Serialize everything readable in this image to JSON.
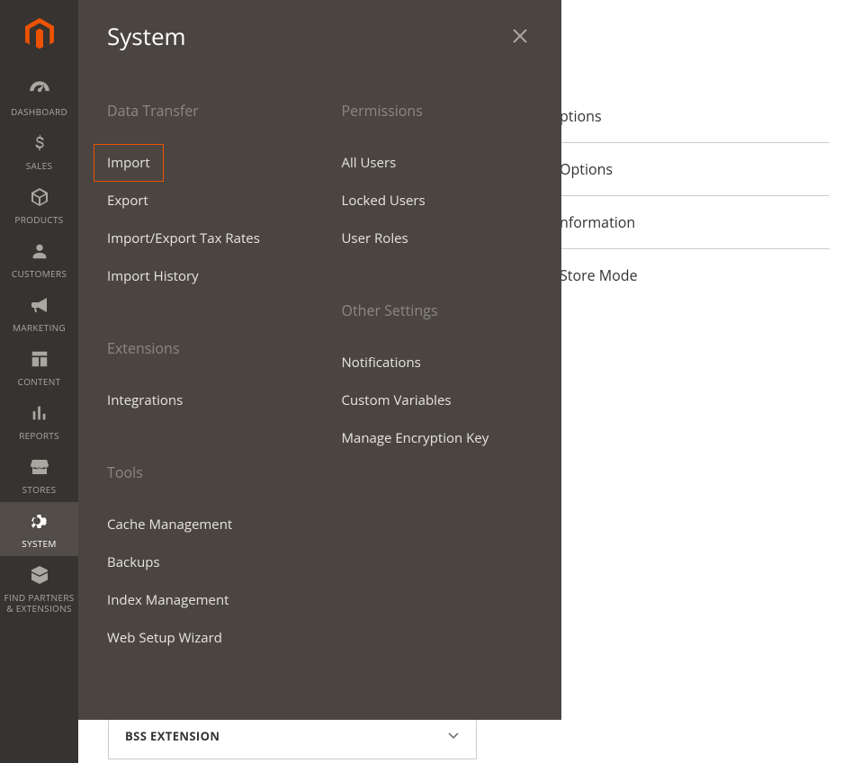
{
  "flyout": {
    "title": "System",
    "col1": [
      {
        "heading": "Data Transfer",
        "items": [
          "Import",
          "Export",
          "Import/Export Tax Rates",
          "Import History"
        ],
        "highlightIndex": 0
      },
      {
        "heading": "Extensions",
        "items": [
          "Integrations"
        ]
      },
      {
        "heading": "Tools",
        "items": [
          "Cache Management",
          "Backups",
          "Index Management",
          "Web Setup Wizard"
        ]
      }
    ],
    "col2": [
      {
        "heading": "Permissions",
        "items": [
          "All Users",
          "Locked Users",
          "User Roles"
        ]
      },
      {
        "heading": "Other Settings",
        "items": [
          "Notifications",
          "Custom Variables",
          "Manage Encryption Key"
        ]
      }
    ]
  },
  "sidebar": {
    "items": [
      {
        "label": "DASHBOARD",
        "icon": "gauge"
      },
      {
        "label": "SALES",
        "icon": "dollar"
      },
      {
        "label": "PRODUCTS",
        "icon": "cube"
      },
      {
        "label": "CUSTOMERS",
        "icon": "person"
      },
      {
        "label": "MARKETING",
        "icon": "megaphone"
      },
      {
        "label": "CONTENT",
        "icon": "layout"
      },
      {
        "label": "REPORTS",
        "icon": "bars"
      },
      {
        "label": "STORES",
        "icon": "storefront"
      },
      {
        "label": "SYSTEM",
        "icon": "gear",
        "active": true
      },
      {
        "label": "FIND PARTNERS & EXTENSIONS",
        "icon": "box"
      }
    ]
  },
  "rightPartial": [
    "ptions",
    "Options",
    "nformation",
    "Store Mode"
  ],
  "bottomBox": {
    "label": "BSS EXTENSION"
  }
}
